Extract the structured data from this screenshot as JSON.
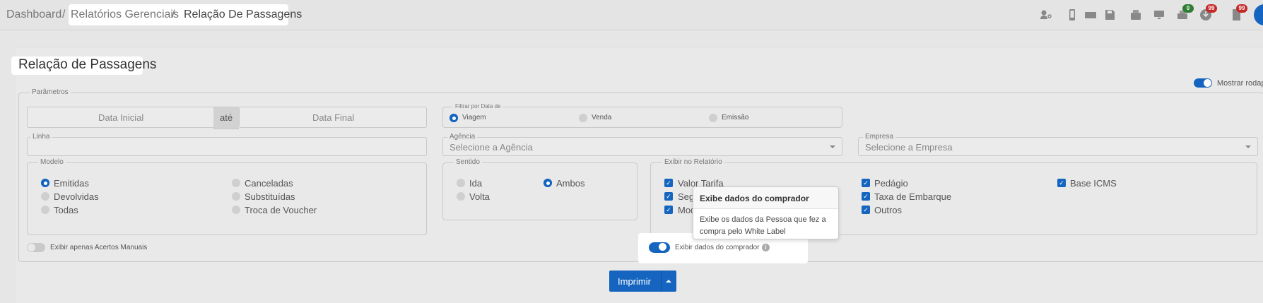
{
  "breadcrumb": {
    "home": "Dashboard",
    "sep1": "/",
    "section": "Relatórios Gerenciais",
    "sep2": "/",
    "current": "Relação De Passagens"
  },
  "toolbar": {
    "icons": [
      "user-key-icon",
      "mobile-icon",
      "ticket-icon",
      "save-icon",
      "fax-icon",
      "monitor-icon",
      "printer-icon",
      "download-icon",
      "document-icon"
    ],
    "badges": {
      "printer": "0",
      "download": "99",
      "document": "99"
    },
    "badge_colors": {
      "printer": "#2e7d32",
      "download": "#c62828",
      "document": "#c62828"
    }
  },
  "page": {
    "title": "Relação de Passagens",
    "show_footer_label": "Mostrar rodap"
  },
  "params": {
    "legend": "Parâmetros",
    "date_from_placeholder": "Data Inicial",
    "date_between": "até",
    "date_to_placeholder": "Data Final",
    "filter_date": {
      "legend": "Filtrar por Data de",
      "options": [
        "Viagem",
        "Venda",
        "Emissão"
      ],
      "selected": "Viagem"
    },
    "linha_label": "Linha",
    "agencia_label": "Agência",
    "agencia_placeholder": "Selecione a Agência",
    "empresa_label": "Empresa",
    "empresa_placeholder": "Selecione a Empresa",
    "modelo": {
      "legend": "Modelo",
      "options": [
        "Emitidas",
        "Devolvidas",
        "Todas",
        "Canceladas",
        "Substituídas",
        "Troca de Voucher"
      ],
      "selected": "Emitidas"
    },
    "sentido": {
      "legend": "Sentido",
      "options": [
        "Ida",
        "Volta",
        "Ambos"
      ],
      "selected": "Ambos"
    },
    "exibir": {
      "legend": "Exibir no Relatório",
      "items": [
        "Valor Tarifa",
        "Seg",
        "Mod",
        "Pedágio",
        "Taxa de Embarque",
        "Outros",
        "Base ICMS"
      ]
    },
    "only_manual_label": "Exibir apenas Acertos Manuais",
    "buyer_toggle_label": "Exibir dados do comprador"
  },
  "tooltip": {
    "title": "Exibe dados do comprador",
    "body": "Exibe os dados da Pessoa que fez a compra pelo White Label"
  },
  "actions": {
    "print_label": "Imprimir"
  },
  "colors": {
    "accent": "#1565c0"
  }
}
